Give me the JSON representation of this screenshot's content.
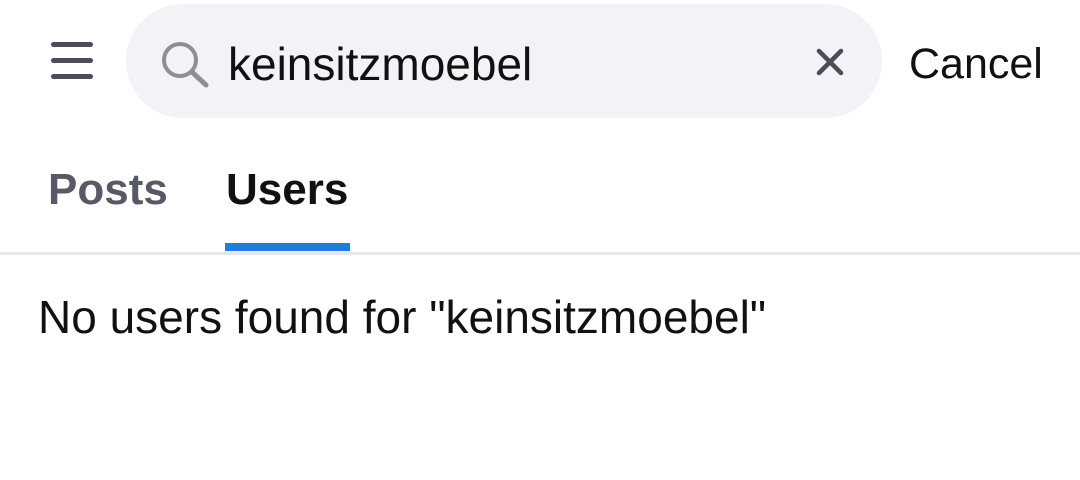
{
  "header": {
    "menu_icon": "hamburger-menu-icon",
    "search": {
      "icon": "search-icon",
      "value": "keinsitzmoebel",
      "clear_icon": "close-icon"
    },
    "cancel_label": "Cancel"
  },
  "tabs": [
    {
      "label": "Posts",
      "active": false
    },
    {
      "label": "Users",
      "active": true
    }
  ],
  "results": {
    "empty_message": "No users found for \"keinsitzmoebel\""
  },
  "colors": {
    "search_background": "#f2f2f7",
    "active_tab_indicator": "#1a7fe0",
    "inactive_tab_text": "#575a66",
    "primary_text": "#111111"
  }
}
